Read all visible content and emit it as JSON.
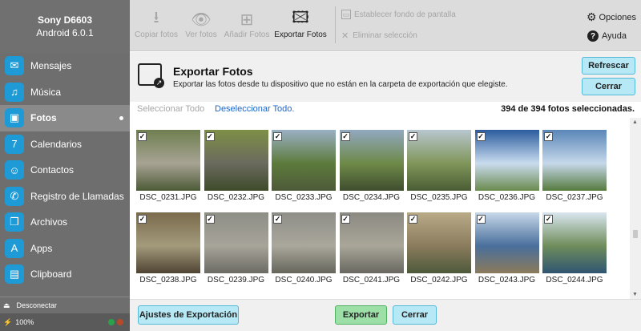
{
  "device": {
    "name": "Sony D6603",
    "android": "Android 6.0.1"
  },
  "sidebar": {
    "items": [
      {
        "label": "Mensajes",
        "icon": "messages-icon",
        "glyph": "✉"
      },
      {
        "label": "Música",
        "icon": "music-icon",
        "glyph": "♫"
      },
      {
        "label": "Fotos",
        "icon": "photos-icon",
        "glyph": "▣"
      },
      {
        "label": "Calendarios",
        "icon": "calendar-icon",
        "glyph": "7"
      },
      {
        "label": "Contactos",
        "icon": "contacts-icon",
        "glyph": "☺"
      },
      {
        "label": "Registro de Llamadas",
        "icon": "phone-icon",
        "glyph": "✆"
      },
      {
        "label": "Archivos",
        "icon": "files-icon",
        "glyph": "❐"
      },
      {
        "label": "Apps",
        "icon": "apps-icon",
        "glyph": "A"
      },
      {
        "label": "Clipboard",
        "icon": "clipboard-icon",
        "glyph": "▤"
      }
    ],
    "active_index": 2,
    "disconnect_label": "Desconectar",
    "battery": "100%"
  },
  "toolbar": {
    "copy": "Copiar fotos",
    "view": "Ver fotos",
    "add": "Añadir Fotos",
    "export": "Exportar Fotos",
    "wallpaper": "Establecer fondo de pantalla",
    "delete": "Eliminar selección",
    "options": "Opciones",
    "help": "Ayuda"
  },
  "header": {
    "title": "Exportar Fotos",
    "description": "Exportar las fotos desde tu dispositivo que no están en la carpeta de exportación que elegiste.",
    "refresh": "Refrescar",
    "close": "Cerrar"
  },
  "selection": {
    "select_all": "Seleccionar Todo",
    "deselect_all": "Deseleccionar Todo.",
    "count": "394 de 394 fotos seleccionadas."
  },
  "photos": {
    "row1": [
      "DSC_0231.JPG",
      "DSC_0232.JPG",
      "DSC_0233.JPG",
      "DSC_0234.JPG",
      "DSC_0235.JPG",
      "DSC_0236.JPG",
      "DSC_0237.JPG"
    ],
    "row2": [
      "DSC_0238.JPG",
      "DSC_0239.JPG",
      "DSC_0240.JPG",
      "DSC_0241.JPG",
      "DSC_0242.JPG",
      "DSC_0243.JPG",
      "DSC_0244.JPG"
    ]
  },
  "bottom": {
    "settings": "Ajustes de Exportación",
    "export": "Exportar",
    "close": "Cerrar"
  },
  "colors": {
    "accent_blue": "#1e9ad6",
    "button_blue": "#b7e8f5",
    "button_green": "#9ce0a8",
    "link_blue": "#1a66c8"
  }
}
